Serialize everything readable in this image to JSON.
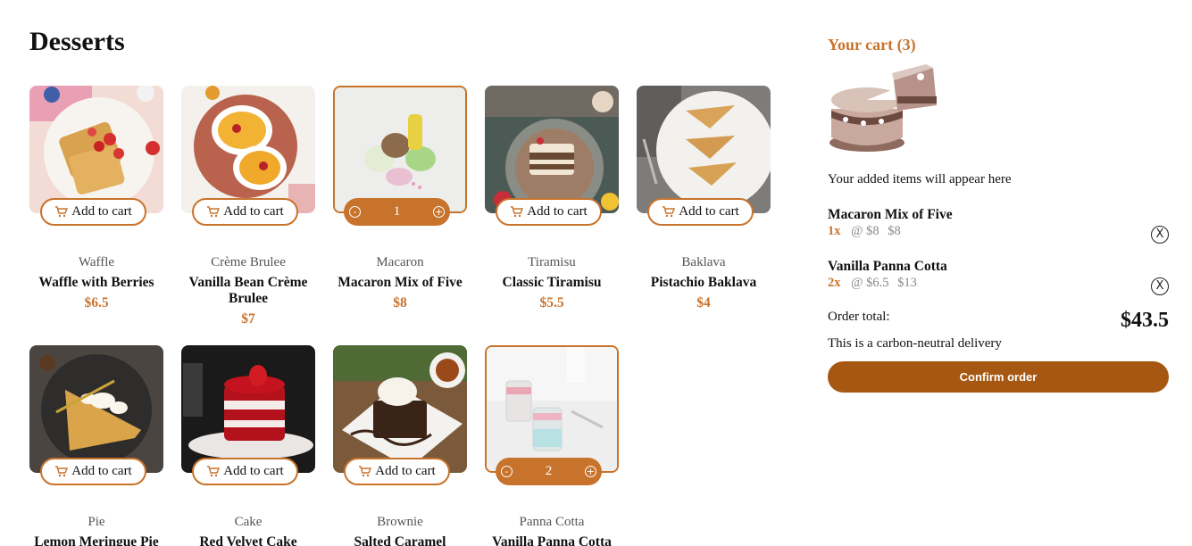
{
  "page": {
    "title": "Desserts"
  },
  "products": [
    {
      "category": "Waffle",
      "name": "Waffle with Berries",
      "price": "$6.5",
      "add_label": "Add to cart",
      "in_cart": false
    },
    {
      "category": "Crème Brulee",
      "name": "Vanilla Bean Crème Brulee",
      "price": "$7",
      "add_label": "Add to cart",
      "in_cart": false
    },
    {
      "category": "Macaron",
      "name": "Macaron Mix of Five",
      "price": "$8",
      "add_label": "Add to cart",
      "in_cart": true,
      "quantity": "1",
      "decrement": "-",
      "increment": "+"
    },
    {
      "category": "Tiramisu",
      "name": "Classic Tiramisu",
      "price": "$5.5",
      "add_label": "Add to cart",
      "in_cart": false
    },
    {
      "category": "Baklava",
      "name": "Pistachio Baklava",
      "price": "$4",
      "add_label": "Add to cart",
      "in_cart": false
    },
    {
      "category": "Pie",
      "name": "Lemon Meringue Pie",
      "price": "",
      "add_label": "Add to cart",
      "in_cart": false
    },
    {
      "category": "Cake",
      "name": "Red Velvet Cake",
      "price": "",
      "add_label": "Add to cart",
      "in_cart": false
    },
    {
      "category": "Brownie",
      "name": "Salted Caramel",
      "price": "",
      "add_label": "Add to cart",
      "in_cart": false
    },
    {
      "category": "Panna Cotta",
      "name": "Vanilla Panna Cotta",
      "price": "",
      "add_label": "Add to cart",
      "in_cart": true,
      "quantity": "2",
      "decrement": "-",
      "increment": "+"
    }
  ],
  "cart": {
    "title": "Your cart (3)",
    "empty_message": "Your added items will appear here",
    "items": [
      {
        "name": "Macaron Mix of Five",
        "qty": "1x",
        "each": "@ $8",
        "line_total": "$8",
        "remove": "X"
      },
      {
        "name": "Vanilla Panna Cotta",
        "qty": "2x",
        "each": "@ $6.5",
        "line_total": "$13",
        "remove": "X"
      }
    ],
    "total_label": "Order total:",
    "total": "$43.5",
    "carbon_note": "This is a carbon-neutral delivery",
    "confirm_label": "Confirm order"
  },
  "colors": {
    "accent": "#c8732c",
    "confirm": "#a65711"
  },
  "icons": {
    "add_to_cart": "cart-plus-icon",
    "decrement": "minus-circle-icon",
    "increment": "plus-circle-icon",
    "remove": "remove-circle-icon",
    "empty_cart": "cake-illustration"
  }
}
